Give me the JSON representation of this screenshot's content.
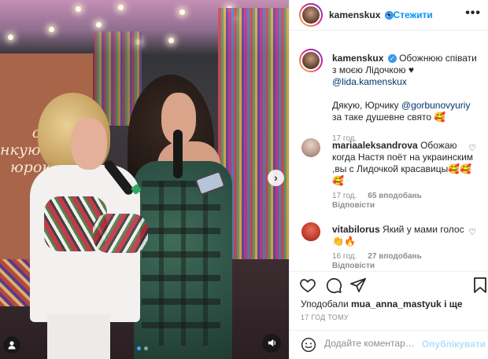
{
  "post": {
    "username": "kamenskux",
    "follow_label": "Стежити",
    "more_label": "•••",
    "caption": {
      "username": "kamenskux",
      "text": "Обожнюю співати з моєю Лідочкою ♥",
      "mention": "@lida.kamenskux",
      "text2": "Дякую, Юрчику",
      "mention2": "@gorbunovyuriy",
      "text3": "за таке душевне свято 🥰",
      "time": "17 год."
    }
  },
  "media": {
    "banner_text": "сні\nнкують\nюрою",
    "next_icon": "chevron-right-icon",
    "user_icon": "person-icon",
    "sound_icon": "speaker-icon",
    "dots_count": 2,
    "active_dot": 0
  },
  "comments": [
    {
      "username": "mariaaleksandrova",
      "text": "Обожаю когда Настя поёт на украинским ,вы с Лидочкой красавицы🥰🥰🥰",
      "time": "17 год.",
      "likes": "65 вподобань",
      "reply": "Відповісти"
    },
    {
      "username": "vitabilorus",
      "text": "Який у мами голос 👏🔥",
      "time": "16 год.",
      "likes": "27 вподобань",
      "reply": "Відповісти"
    }
  ],
  "actions": {
    "liked_by_label": "Уподобали",
    "liked_by_user": "mua_anna_mastyuk",
    "liked_by_more": "і ще",
    "timestamp": "17 ГОД ТОМУ"
  },
  "comment_box": {
    "placeholder": "Додайте коментар…",
    "publish_label": "Опублікувати"
  }
}
